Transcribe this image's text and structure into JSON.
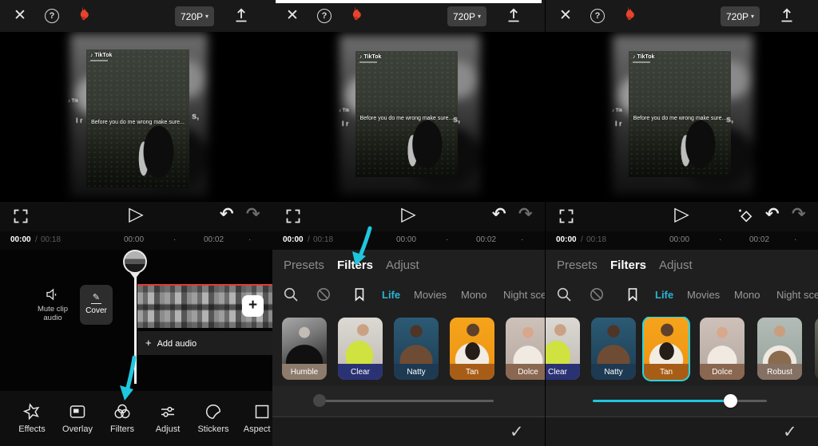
{
  "header": {
    "resolution": "720P"
  },
  "icons": {
    "close": "✕",
    "help": "?",
    "caret": "▾",
    "play": "▷",
    "undo": "↶",
    "redo": "↷",
    "check": "✓",
    "dot": "·",
    "plus": "+",
    "pencil": "✎"
  },
  "player": {
    "current_time": "00:00",
    "divider": "/",
    "total_time": "00:18",
    "ruler_ticks": [
      "00:00",
      "00:02"
    ]
  },
  "preview": {
    "watermark": "♪ TikTok",
    "caption": "Before you do me wrong make sure...",
    "echo_watermark": "♪ Tik",
    "echo_left": "I r",
    "echo_right": "s,"
  },
  "timeline": {
    "mute_label": "Mute clip audio",
    "cover_label": "Cover",
    "add_audio_label": "Add audio"
  },
  "toolbar": [
    {
      "label": "Effects"
    },
    {
      "label": "Overlay"
    },
    {
      "label": "Filters"
    },
    {
      "label": "Adjust"
    },
    {
      "label": "Stickers"
    },
    {
      "label": "Aspect ra"
    }
  ],
  "sheet": {
    "tabs": [
      {
        "label": "Presets"
      },
      {
        "label": "Filters"
      },
      {
        "label": "Adjust"
      }
    ],
    "active_tab": "Filters",
    "categories": [
      {
        "label": "Life"
      },
      {
        "label": "Movies"
      },
      {
        "label": "Mono"
      },
      {
        "label": "Night sce"
      }
    ],
    "active_category": "Life",
    "filters_step1": [
      {
        "name": "Humble",
        "bar_color": "#8d7b6c"
      },
      {
        "name": "Clear",
        "bar_color": "#2b3274"
      },
      {
        "name": "Natty",
        "bar_color": "#1e3a52"
      },
      {
        "name": "Tan",
        "bar_color": "#a85d16"
      },
      {
        "name": "Dolce",
        "bar_color": "#8a6750"
      }
    ],
    "filters_step2": [
      {
        "name": "Clear",
        "bar_color": "#2b3274"
      },
      {
        "name": "Natty",
        "bar_color": "#1e3a52"
      },
      {
        "name": "Tan",
        "bar_color": "#a85d16",
        "selected": true
      },
      {
        "name": "Dolce",
        "bar_color": "#8a6750"
      },
      {
        "name": "Robust",
        "bar_color": "#857163"
      }
    ],
    "intensity_step1": 0,
    "intensity_step2": 79
  },
  "colors": {
    "accent": "#1fc7de",
    "selection": "#2ad4e0",
    "active_category": "#2bb3d4",
    "red_line": "#e53935"
  }
}
